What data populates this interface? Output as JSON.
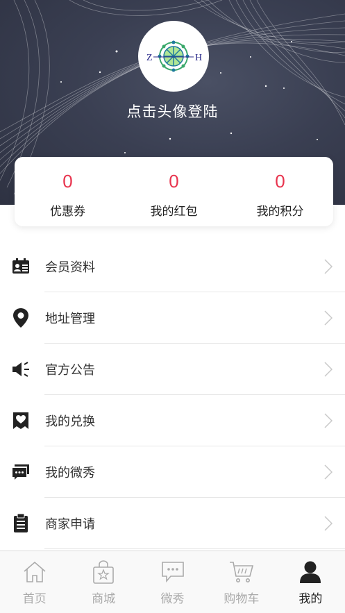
{
  "profile": {
    "avatar_letters": [
      "Z",
      "H"
    ],
    "login_prompt": "点击头像登陆"
  },
  "stats": [
    {
      "value": "0",
      "label": "优惠券"
    },
    {
      "value": "0",
      "label": "我的红包"
    },
    {
      "value": "0",
      "label": "我的积分"
    }
  ],
  "menu": [
    {
      "label": "会员资料",
      "icon": "member-card-icon"
    },
    {
      "label": "地址管理",
      "icon": "location-pin-icon"
    },
    {
      "label": "官方公告",
      "icon": "megaphone-icon"
    },
    {
      "label": "我的兑换",
      "icon": "heart-ticket-icon"
    },
    {
      "label": "我的微秀",
      "icon": "chat-bubble-icon"
    },
    {
      "label": "商家申请",
      "icon": "clipboard-icon"
    }
  ],
  "tabbar": [
    {
      "label": "首页",
      "icon": "home-icon",
      "active": false
    },
    {
      "label": "商城",
      "icon": "shopping-bag-icon",
      "active": false
    },
    {
      "label": "微秀",
      "icon": "chat-icon",
      "active": false
    },
    {
      "label": "购物车",
      "icon": "cart-icon",
      "active": false
    },
    {
      "label": "我的",
      "icon": "user-icon",
      "active": true
    }
  ],
  "colors": {
    "accent": "#e8344e",
    "header_bg": "#3a3f52",
    "icon": "#222222",
    "tab_inactive": "#aaaaaa"
  }
}
